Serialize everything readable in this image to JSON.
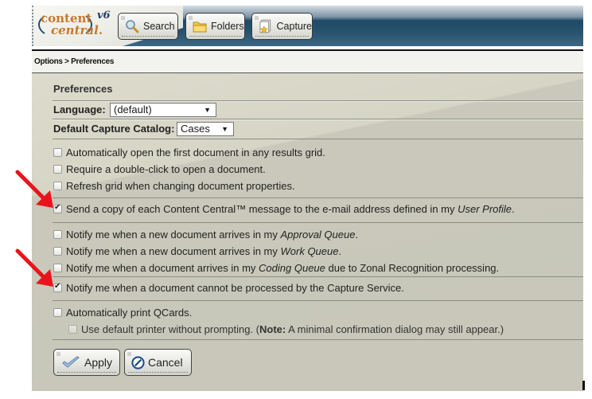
{
  "logo": {
    "line1": "content",
    "line2": "central.",
    "version": "v6"
  },
  "nav": [
    {
      "label": "Search",
      "icon": "magnifier-icon"
    },
    {
      "label": "Folders",
      "icon": "folder-icon"
    },
    {
      "label": "Capture",
      "icon": "capture-document-icon"
    }
  ],
  "breadcrumb": "Options > Preferences",
  "panel": {
    "title": "Preferences",
    "language": {
      "label": "Language:",
      "value": "(default)"
    },
    "catalog": {
      "label": "Default Capture Catalog:",
      "value": "Cases"
    },
    "options": [
      {
        "text": "Automatically open the first document in any results grid.",
        "checked": false
      },
      {
        "text": "Require a double-click to open a document.",
        "checked": false
      },
      {
        "text": "Refresh grid when changing document properties.",
        "checked": false
      },
      {
        "pre": "Send a copy of each Content Central™ message to the e-mail address defined in my ",
        "em": "User Profile",
        "post": ".",
        "checked": true
      },
      {
        "pre": "Notify me when a new document arrives in my ",
        "em": "Approval Queue",
        "post": ".",
        "checked": false
      },
      {
        "pre": "Notify me when a new document arrives in my ",
        "em": "Work Queue",
        "post": ".",
        "checked": false
      },
      {
        "pre": "Notify me when a document arrives in my ",
        "em": "Coding Queue",
        "post": " due to Zonal Recognition processing.",
        "checked": false
      },
      {
        "text": "Notify me when a document cannot be processed by the Capture Service.",
        "checked": true
      },
      {
        "text": "Automatically print QCards.",
        "checked": false
      },
      {
        "pre": "Use default printer without prompting. (",
        "bold": "Note:",
        "post": " A minimal confirmation dialog may still appear.)",
        "checked": false,
        "disabled": true
      }
    ],
    "apply_label": "Apply",
    "cancel_label": "Cancel"
  },
  "annotation_color": "#e8141b"
}
